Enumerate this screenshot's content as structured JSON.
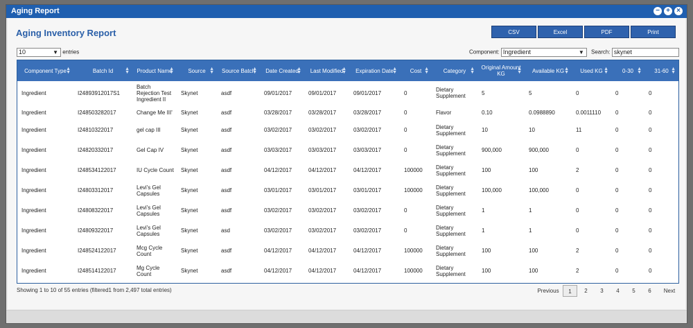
{
  "window": {
    "title": "Aging Report",
    "buttons": [
      "−",
      "+",
      "×"
    ]
  },
  "report": {
    "title": "Aging Inventory Report"
  },
  "exports": [
    "CSV",
    "Excel",
    "PDF",
    "Print"
  ],
  "length": {
    "value": "10",
    "label": "entries"
  },
  "component": {
    "label": "Component:",
    "value": "Ingredient"
  },
  "search": {
    "label": "Search:",
    "value": "skynet"
  },
  "table": {
    "headers": [
      "Component Type",
      "Batch Id",
      "Product Name",
      "Source",
      "Source Batch",
      "Date Created",
      "Last Modified",
      "Expiration Date",
      "Cost",
      "Category",
      "Original Amount KG",
      "Available KG",
      "Used KG",
      "0-30",
      "31-60"
    ],
    "rows": [
      [
        "Ingredient",
        "I24893912017S1",
        "Batch Rejection Test Ingredient II",
        "Skynet",
        "asdf",
        "09/01/2017",
        "09/01/2017",
        "09/01/2017",
        "0",
        "Dietary Supplement",
        "5",
        "5",
        "0",
        "0",
        "0"
      ],
      [
        "Ingredient",
        "I248503282017",
        "Change Me III'",
        "Skynet",
        "asdf",
        "03/28/2017",
        "03/28/2017",
        "03/28/2017",
        "0",
        "Flavor",
        "0.10",
        "0.0988890",
        "0.0011110",
        "0",
        "0"
      ],
      [
        "Ingredient",
        "I24810322017",
        "gel cap III",
        "Skynet",
        "asdf",
        "03/02/2017",
        "03/02/2017",
        "03/02/2017",
        "0",
        "Dietary Supplement",
        "10",
        "10",
        "11",
        "0",
        "0"
      ],
      [
        "Ingredient",
        "I24820332017",
        "Gel Cap IV",
        "Skynet",
        "asdf",
        "03/03/2017",
        "03/03/2017",
        "03/03/2017",
        "0",
        "Dietary Supplement",
        "900,000",
        "900,000",
        "0",
        "0",
        "0"
      ],
      [
        "Ingredient",
        "I248534122017",
        "IU Cycle Count",
        "Skynet",
        "asdf",
        "04/12/2017",
        "04/12/2017",
        "04/12/2017",
        "100000",
        "Dietary Supplement",
        "100",
        "100",
        "2",
        "0",
        "0"
      ],
      [
        "Ingredient",
        "I24803312017",
        "Levi's Gel Capsules",
        "Skynet",
        "asdf",
        "03/01/2017",
        "03/01/2017",
        "03/01/2017",
        "100000",
        "Dietary Supplement",
        "100,000",
        "100,000",
        "0",
        "0",
        "0"
      ],
      [
        "Ingredient",
        "I24808322017",
        "Levi's Gel Capsules",
        "Skynet",
        "asdf",
        "03/02/2017",
        "03/02/2017",
        "03/02/2017",
        "0",
        "Dietary Supplement",
        "1",
        "1",
        "0",
        "0",
        "0"
      ],
      [
        "Ingredient",
        "I24809322017",
        "Levi's Gel Capsules",
        "Skynet",
        "asd",
        "03/02/2017",
        "03/02/2017",
        "03/02/2017",
        "0",
        "Dietary Supplement",
        "1",
        "1",
        "0",
        "0",
        "0"
      ],
      [
        "Ingredient",
        "I248524122017",
        "Mcg Cycle Count",
        "Skynet",
        "asdf",
        "04/12/2017",
        "04/12/2017",
        "04/12/2017",
        "100000",
        "Dietary Supplement",
        "100",
        "100",
        "2",
        "0",
        "0"
      ],
      [
        "Ingredient",
        "I248514122017",
        "Mg Cycle Count",
        "Skynet",
        "asdf",
        "04/12/2017",
        "04/12/2017",
        "04/12/2017",
        "100000",
        "Dietary Supplement",
        "100",
        "100",
        "2",
        "0",
        "0"
      ]
    ]
  },
  "info": "Showing 1 to 10 of 55 entries (filtered1 from 2,497 total entries)",
  "pagination": {
    "previous": "Previous",
    "pages": [
      "1",
      "2",
      "3",
      "4",
      "5",
      "6"
    ],
    "current": "1",
    "next": "Next"
  },
  "colors": {
    "titlebar": "#1f5fb0",
    "header": "#3a70b9",
    "title": "#2a5fa8",
    "button": "#2f62ad"
  }
}
